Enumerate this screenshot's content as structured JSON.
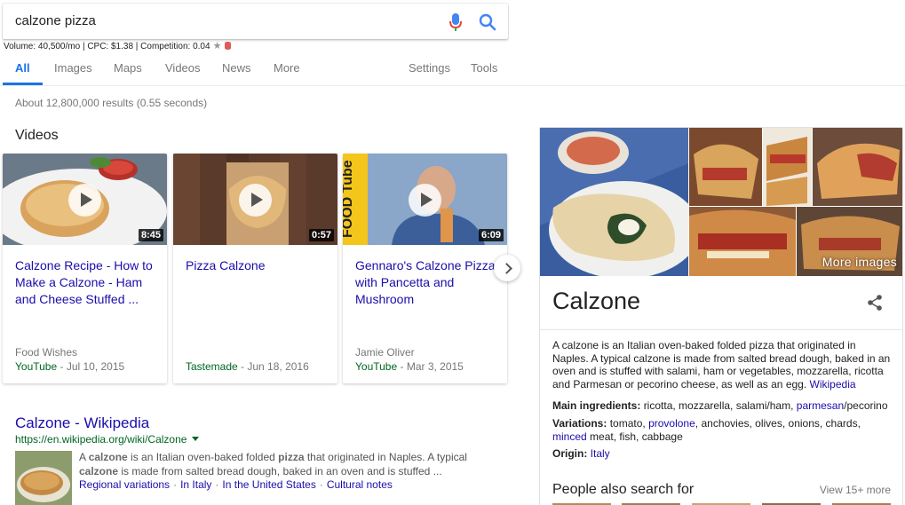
{
  "search": {
    "query": "calzone pizza",
    "keyword_stats": "Volume: 40,500/mo | CPC: $1.38 | Competition: 0.04"
  },
  "tabs": [
    {
      "label": "All",
      "active": true
    },
    {
      "label": "Images"
    },
    {
      "label": "Maps"
    },
    {
      "label": "Videos"
    },
    {
      "label": "News"
    },
    {
      "label": "More"
    },
    {
      "label": "Settings"
    },
    {
      "label": "Tools"
    }
  ],
  "results_count": "About 12,800,000 results (0.55 seconds)",
  "videos": {
    "heading": "Videos",
    "items": [
      {
        "title": "Calzone Recipe - How to Make a Calzone - Ham and Cheese Stuffed ...",
        "duration": "8:45",
        "author": "Food Wishes",
        "site": "YouTube",
        "date": " - Jul 10, 2015"
      },
      {
        "title": "Pizza Calzone",
        "duration": "0:57",
        "author": "",
        "site": "Tastemade",
        "date": " - Jun 18, 2016"
      },
      {
        "title": "Gennaro's Calzone Pizza with Pancetta and Mushroom",
        "duration": "6:09",
        "author": "Jamie Oliver",
        "site": "YouTube",
        "date": " - Mar 3, 2015",
        "badge": "FOOD Tube"
      }
    ]
  },
  "wiki_result": {
    "title": "Calzone - Wikipedia",
    "url": "https://en.wikipedia.org/wiki/Calzone",
    "snippet_parts": [
      "A ",
      "calzone",
      " is an Italian oven-baked folded ",
      "pizza",
      " that originated in Naples. A typical ",
      "calzone",
      " is made from salted bread dough, baked in an oven and is stuffed ..."
    ],
    "links": [
      "Regional variations",
      "In Italy",
      "In the United States",
      "Cultural notes"
    ]
  },
  "knowledge_panel": {
    "more_images": "More images",
    "title": "Calzone",
    "description": "A calzone is an Italian oven-baked folded pizza that originated in Naples. A typical calzone is made from salted bread dough, baked in an oven and is stuffed with salami, ham or vegetables, mozzarella, ricotta and Parmesan or pecorino cheese, as well as an egg.",
    "description_link": "Wikipedia",
    "main_ingredients_label": "Main ingredients:",
    "main_ingredients_text": "ricotta, mozzarella, salami/ham,",
    "main_ingredients_link": "parmesan",
    "main_ingredients_tail": "/pecorino",
    "variations_label": "Variations:",
    "variations_a": "tomato,",
    "variations_link1": "provolone",
    "variations_b": ", anchovies, olives, onions, chards,",
    "variations_link2": "minced",
    "variations_c": "meat, fish, cabbage",
    "origin_label": "Origin:",
    "origin_link": "Italy",
    "people_also_search": "People also search for",
    "view_more": "View 15+ more"
  },
  "colors": {
    "link": "#1a0dab",
    "url_green": "#006621",
    "accent_blue": "#1a73e8"
  }
}
